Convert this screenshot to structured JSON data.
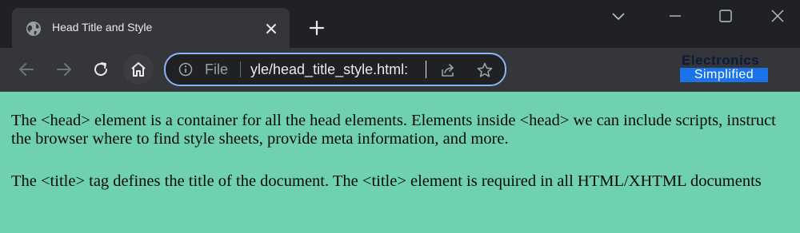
{
  "browser": {
    "tab": {
      "title": "Head Title and Style",
      "favicon": "globe-icon"
    },
    "new_tab": "plus-icon",
    "window_controls": [
      "chevron-down-icon",
      "minimize-icon",
      "maximize-icon",
      "close-icon"
    ],
    "toolbar": {
      "scheme_label": "File",
      "url_visible": ":yle/head_title_style.html",
      "icons": [
        "back-arrow-icon",
        "forward-arrow-icon",
        "reload-icon",
        "home-icon",
        "info-icon",
        "share-icon",
        "star-icon"
      ]
    },
    "logo": {
      "line1": "Electronics",
      "line2": "Simplified"
    }
  },
  "page": {
    "background": "#6fd1b0",
    "paragraphs": [
      "The <head> element is a container for all the head elements. Elements inside <head> we can include scripts, instruct the browser where to find style sheets, provide meta information, and more.",
      "The <title> tag defines the title of the document. The <title> element is required in all HTML/XHTML documents"
    ]
  },
  "colors": {
    "frame": "#202124",
    "toolbar": "#35363a",
    "omnibox_border": "#8ab4f8",
    "logo_blue": "#1a73e8"
  }
}
